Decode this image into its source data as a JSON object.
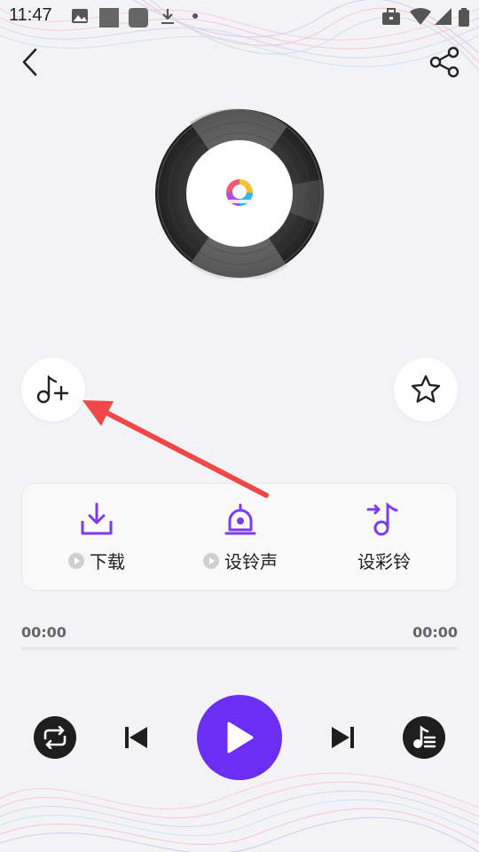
{
  "status_bar": {
    "time": "11:47",
    "left_icons": [
      "gallery-icon",
      "square-icon",
      "square-icon",
      "download-icon",
      "dot-icon"
    ],
    "right_icons": [
      "briefcase-icon",
      "wifi-icon",
      "signal-icon",
      "battery-icon"
    ]
  },
  "header": {
    "back_icon": "chevron-left-icon",
    "share_icon": "share-icon"
  },
  "disc": {
    "label_icon": "app-logo"
  },
  "side_buttons": {
    "add_to_playlist_icon": "music-note-plus-icon",
    "favorite_icon": "star-icon"
  },
  "actions": [
    {
      "label": "下载",
      "icon": "download-tray-icon",
      "preview": true
    },
    {
      "label": "设铃声",
      "icon": "alarm-bell-icon",
      "preview": true
    },
    {
      "label": "设彩铃",
      "icon": "music-note-arrow-icon",
      "preview": false
    }
  ],
  "player": {
    "current_time": "00:00",
    "total_time": "00:00",
    "progress": 0,
    "mode_icon": "repeat-icon",
    "prev_icon": "skip-previous-icon",
    "play_icon": "play-icon",
    "next_icon": "skip-next-icon",
    "list_icon": "playlist-icon"
  },
  "colors": {
    "accent": "#6b2ef5",
    "pointer": "#f04848",
    "dark_button": "#1e1e1e",
    "background": "#f3f2f5"
  }
}
